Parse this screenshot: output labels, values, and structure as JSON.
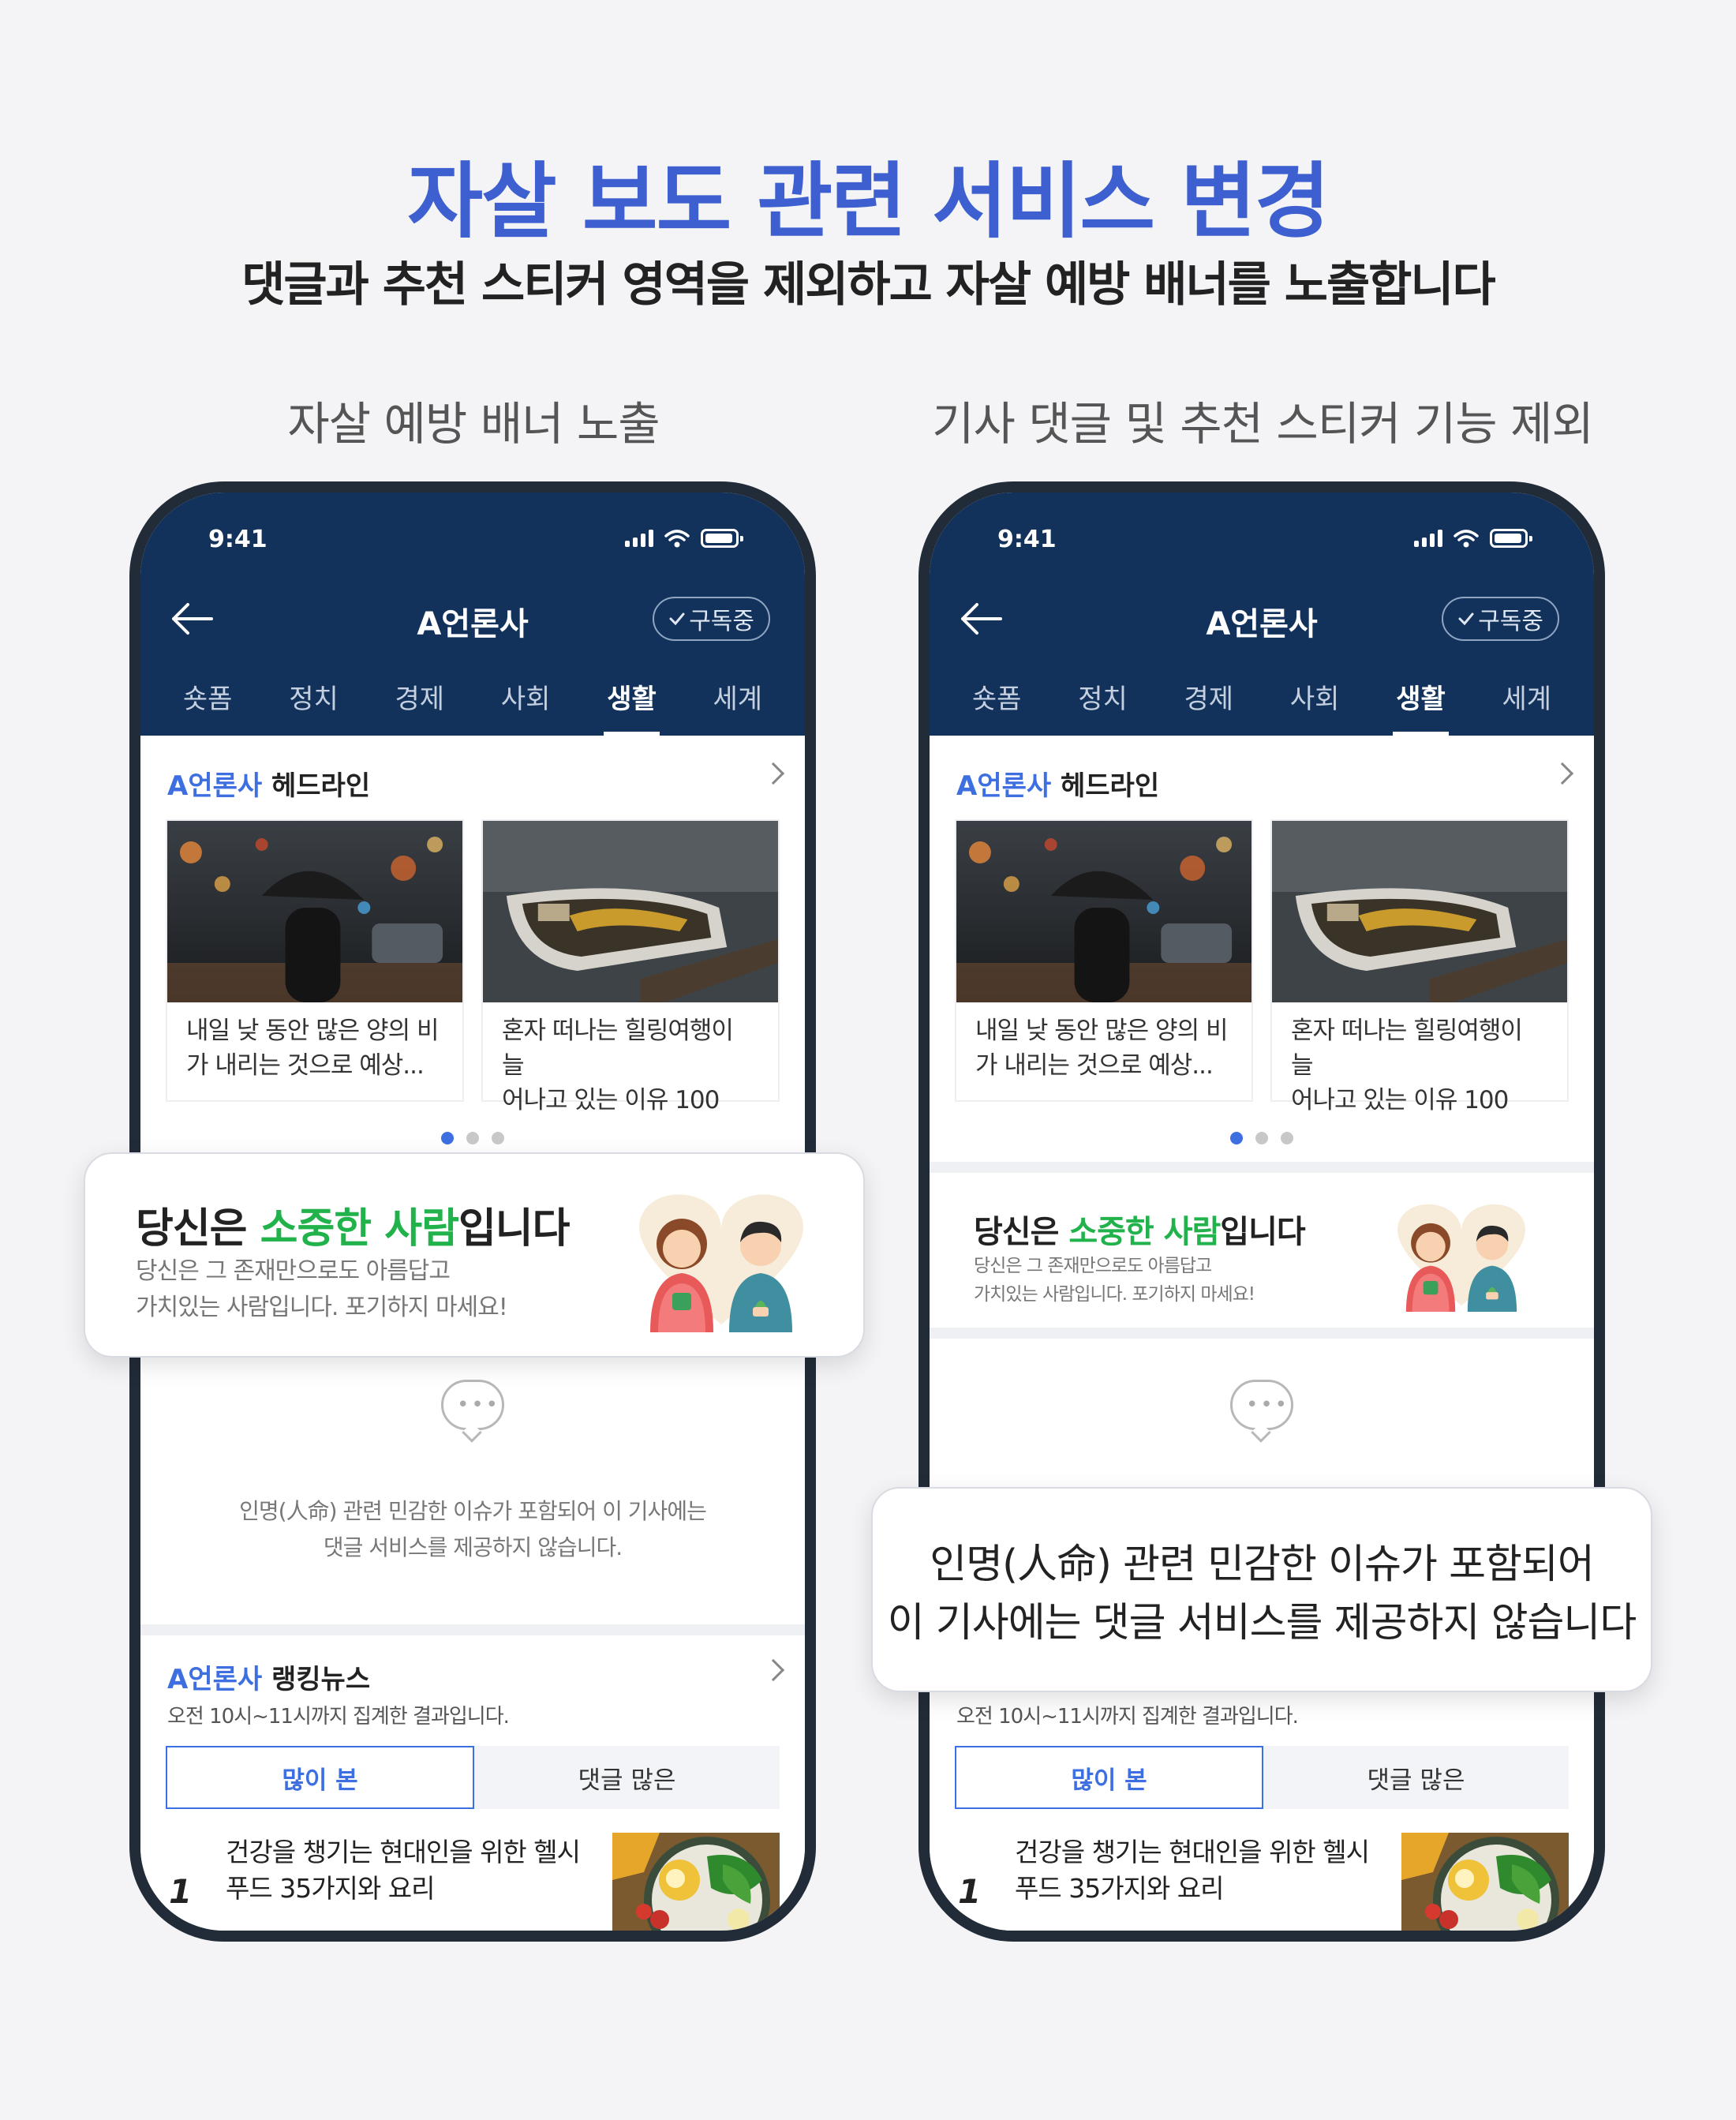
{
  "page": {
    "title": "자살 보도 관련 서비스 변경",
    "subtitle": "댓글과 추천 스티커 영역을 제외하고 자살 예방 배너를 노출합니다"
  },
  "columns": {
    "left_label": "자살 예방 배너 노출",
    "right_label": "기사 댓글 및 추천 스티커 기능 제외"
  },
  "phone": {
    "time": "9:41",
    "press_name": "A언론사",
    "subscribe_label": "구독중",
    "categories": [
      "숏폼",
      "정치",
      "경제",
      "사회",
      "생활",
      "세계"
    ],
    "active_category": "생활",
    "headline": {
      "press": "A언론사",
      "title": "헤드라인",
      "cards": [
        {
          "line1": "내일 낮 동안 많은 양의 비",
          "line2": "가 내리는 것으로 예상..."
        },
        {
          "line1": "혼자 떠나는 힐링여행이 늘",
          "line2": "어나고 있는 이유 100"
        }
      ]
    },
    "banner": {
      "title_pre": "당신은 ",
      "title_highlight": "소중한 사람",
      "title_post": "입니다",
      "desc_line1": "당신은 그 존재만으로도 아름답고",
      "desc_line2": "가치있는 사람입니다. 포기하지 마세요!"
    },
    "comment_notice": {
      "line1": "인명(人命) 관련 민감한 이슈가 포함되어 이 기사에는",
      "line2": "댓글 서비스를 제공하지 않습니다."
    },
    "ranking": {
      "press": "A언론사",
      "title": "랭킹뉴스",
      "subtitle": "오전 10시~11시까지 집계한 결과입니다.",
      "tabs": [
        "많이 본",
        "댓글 많은"
      ],
      "active_tab": "많이 본",
      "items": [
        {
          "rank": "1",
          "line1": "건강을 챙기는 현대인을 위한 헬시",
          "line2": "푸드 35가지와 요리"
        }
      ]
    }
  },
  "callout": {
    "line1": "인명(人命) 관련 민감한 이슈가 포함되어",
    "line2": "이 기사에는 댓글 서비스를 제공하지 않습니다"
  },
  "colors": {
    "accent": "#3d5fd0",
    "header_bg": "#12325c",
    "highlight_green": "#22b24c",
    "link_blue": "#3d6fe0"
  }
}
